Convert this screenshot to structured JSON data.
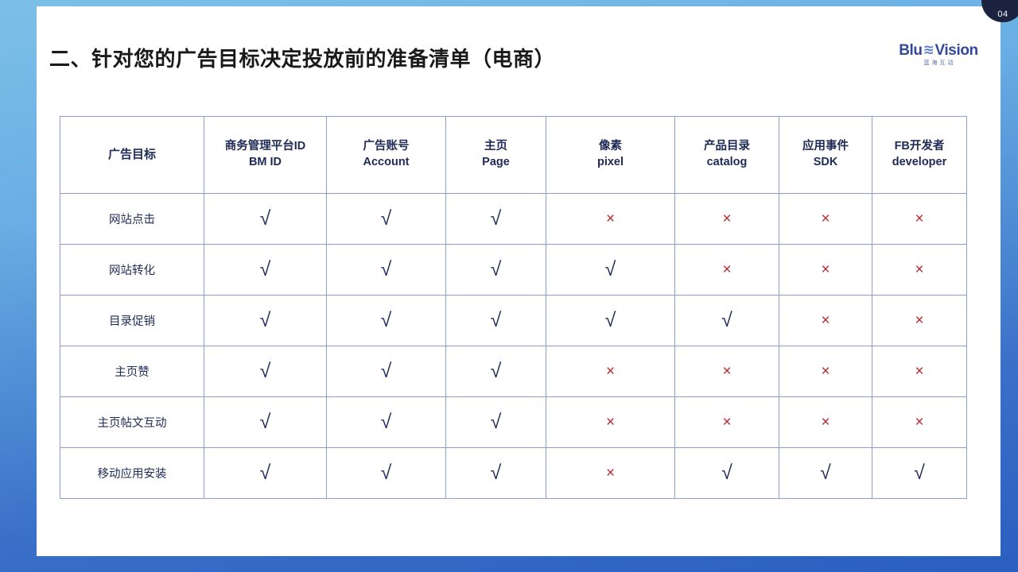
{
  "slide": {
    "title": "二、针对您的广告目标决定投放前的准备清单（电商）",
    "page_number": "04",
    "accent_color": "#3a70c8",
    "frame_color": "#7cc0e8"
  },
  "logo": {
    "name_left": "Blu",
    "wave": "≋",
    "name_right": "Vision",
    "subtitle": "蓝海互动",
    "color": "#33479b"
  },
  "table": {
    "headers": [
      {
        "cn": "广告目标",
        "en": ""
      },
      {
        "cn": "商务管理平台ID",
        "en": "BM ID"
      },
      {
        "cn": "广告账号",
        "en": "Account"
      },
      {
        "cn": "主页",
        "en": "Page"
      },
      {
        "cn": "像素",
        "en": "pixel"
      },
      {
        "cn": "产品目录",
        "en": "catalog"
      },
      {
        "cn": "应用事件",
        "en": "SDK"
      },
      {
        "cn": "FB开发者",
        "en": "developer"
      }
    ],
    "yes_mark": "√",
    "no_mark": "×",
    "yes_color": "#1f2a55",
    "no_color": "#c0272d",
    "rows": [
      {
        "label": "网站点击",
        "marks": [
          "yes",
          "yes",
          "yes",
          "no",
          "no",
          "no",
          "no"
        ]
      },
      {
        "label": "网站转化",
        "marks": [
          "yes",
          "yes",
          "yes",
          "yes",
          "no",
          "no",
          "no"
        ]
      },
      {
        "label": "目录促销",
        "marks": [
          "yes",
          "yes",
          "yes",
          "yes",
          "yes",
          "no",
          "no"
        ]
      },
      {
        "label": "主页赞",
        "marks": [
          "yes",
          "yes",
          "yes",
          "no",
          "no",
          "no",
          "no"
        ]
      },
      {
        "label": "主页帖文互动",
        "marks": [
          "yes",
          "yes",
          "yes",
          "no",
          "no",
          "no",
          "no"
        ]
      },
      {
        "label": "移动应用安装",
        "marks": [
          "yes",
          "yes",
          "yes",
          "no",
          "yes",
          "yes",
          "yes"
        ]
      }
    ]
  }
}
